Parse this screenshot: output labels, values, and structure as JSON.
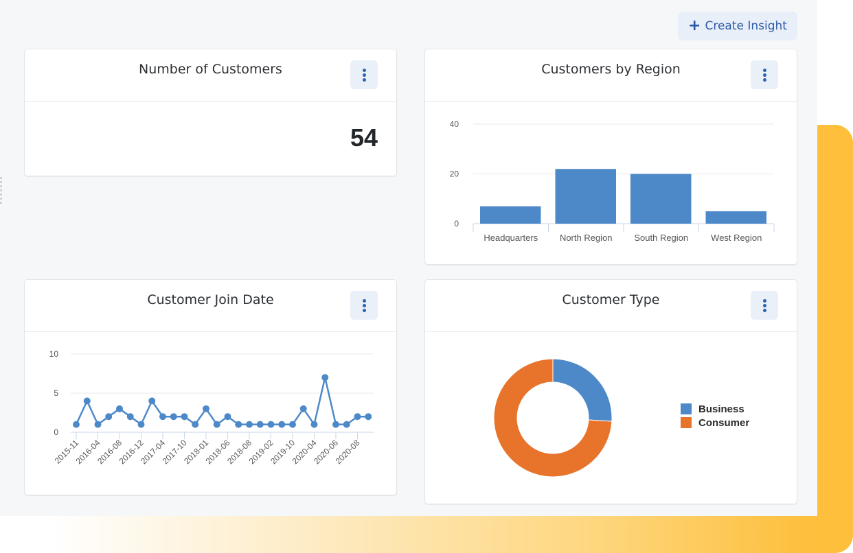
{
  "toolbar": {
    "create_insight_label": "Create Insight",
    "create_insight_icon": "plus-icon"
  },
  "colors": {
    "primary_blue": "#4d89c8",
    "orange": "#e8742c",
    "button_bg": "#e9eff8",
    "button_text": "#2f5da8",
    "accent_yellow": "#fdbf3c"
  },
  "cards": {
    "customers_count": {
      "title": "Number of Customers",
      "value": "54",
      "menu_icon": "kebab-icon"
    },
    "by_region": {
      "title": "Customers by Region",
      "menu_icon": "kebab-icon"
    },
    "join_date": {
      "title": "Customer Join Date",
      "menu_icon": "kebab-icon"
    },
    "customer_type": {
      "title": "Customer Type",
      "menu_icon": "kebab-icon"
    }
  },
  "chart_data": [
    {
      "id": "region",
      "type": "bar",
      "title": "Customers by Region",
      "categories": [
        "Headquarters",
        "North Region",
        "South Region",
        "West Region"
      ],
      "values": [
        7,
        22,
        20,
        5
      ],
      "yticks": [
        "0",
        "20",
        "40"
      ],
      "ylim": [
        0,
        40
      ],
      "grid": true,
      "xlabel": "",
      "ylabel": ""
    },
    {
      "id": "join",
      "type": "line",
      "title": "Customer Join Date",
      "values": [
        1,
        4,
        1,
        2,
        3,
        2,
        1,
        4,
        2,
        2,
        2,
        1,
        3,
        1,
        2,
        1,
        1,
        1,
        1,
        1,
        1,
        3,
        1,
        7,
        1,
        1,
        2,
        2
      ],
      "xtick_labels": [
        "2015-11",
        "2016-04",
        "2016-08",
        "2016-12",
        "2017-04",
        "2017-10",
        "2018-01",
        "2018-06",
        "2018-08",
        "2019-02",
        "2019-10",
        "2020-04",
        "2020-06",
        "2020-08"
      ],
      "xtick_every": 2,
      "yticks": [
        "0",
        "5",
        "10"
      ],
      "ylim": [
        0,
        10
      ],
      "grid": true,
      "xlabel": "",
      "ylabel": ""
    },
    {
      "id": "type",
      "type": "pie",
      "title": "Customer Type",
      "donut": true,
      "labels": [
        "Business",
        "Consumer"
      ],
      "values": [
        14,
        40
      ],
      "colors": [
        "#4d89c8",
        "#e8742c"
      ],
      "legend": "right"
    }
  ]
}
